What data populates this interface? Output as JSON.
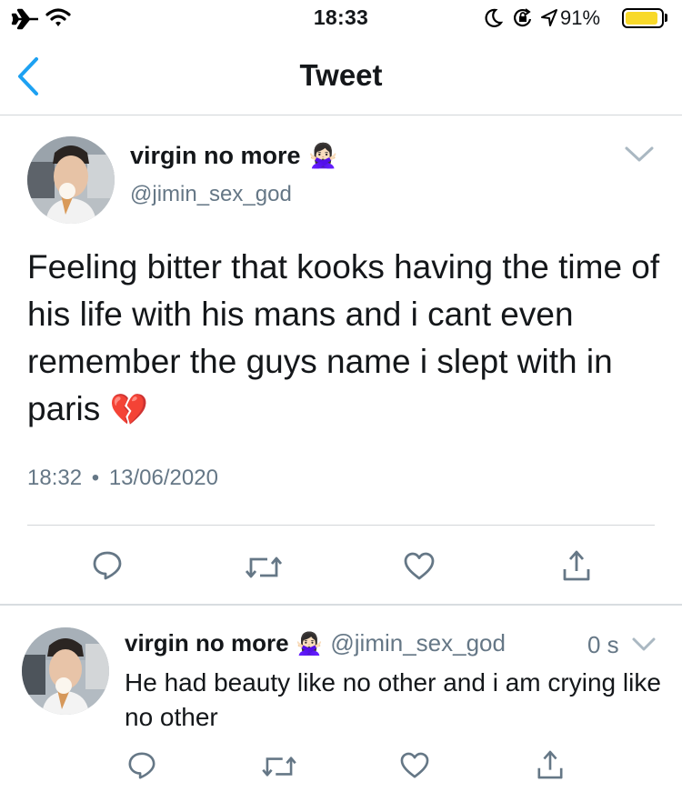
{
  "status_bar": {
    "time": "18:33",
    "battery_percent": "91%",
    "battery_level": 0.91,
    "icons": [
      "airplane-icon",
      "wifi-icon",
      "moon-icon",
      "rotation-lock-icon",
      "location-arrow-icon",
      "battery-icon"
    ]
  },
  "nav": {
    "title": "Tweet",
    "back_icon": "chevron-left-icon"
  },
  "main_tweet": {
    "display_name": "virgin no more",
    "name_emoji": "🙅🏻‍♀️",
    "handle": "@jimin_sex_god",
    "text": "Feeling bitter that kooks having the time of his life with his mans and i cant even remember the guys name i slept with in paris",
    "text_emoji": "💔",
    "time": "18:32",
    "separator": "•",
    "date": "13/06/2020",
    "actions": [
      "reply-icon",
      "retweet-icon",
      "like-icon",
      "share-icon"
    ]
  },
  "reply_tweet": {
    "display_name": "virgin no more",
    "name_emoji": "🙅🏻‍♀️",
    "handle": "@jimin_sex_god",
    "age": "0 s",
    "text": "He had beauty like no other and i am crying like no other",
    "actions": [
      "reply-icon",
      "retweet-icon",
      "like-icon",
      "share-icon"
    ]
  },
  "colors": {
    "accent": "#1da1f2",
    "text": "#14171a",
    "secondary_text": "#657786",
    "action_icon": "#657786",
    "battery": "#f8d92a",
    "divider": "#d2d6d9"
  }
}
